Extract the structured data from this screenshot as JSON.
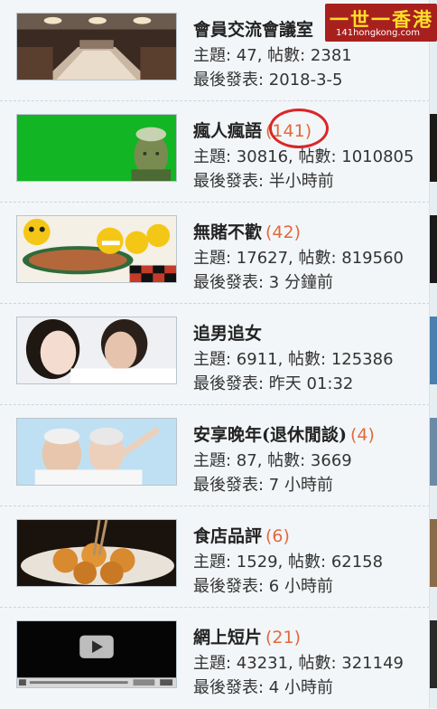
{
  "forums": [
    {
      "title": "會員交流會議室",
      "count": "",
      "topics": "主題: 47, 帖數: 2381",
      "last": "最後發表: 2018-3-5",
      "thumb": "conference-room"
    },
    {
      "title": "瘋人瘋語",
      "count": "(141)",
      "topics": "主題: 30816, 帖數: 1010805",
      "last": "最後發表: 半小時前",
      "thumb": "green-portrait"
    },
    {
      "title": "無賭不歡",
      "count": "(42)",
      "topics": "主題: 17627, 帖數: 819560",
      "last": "最後發表: 3 分鐘前",
      "thumb": "emoji-gambling"
    },
    {
      "title": "追男追女",
      "count": "",
      "topics": "主題: 6911, 帖數: 125386",
      "last": "最後發表: 昨天 01:32",
      "thumb": "couple"
    },
    {
      "title": "安享晚年(退休閒談)",
      "count": "(4)",
      "topics": "主題: 87, 帖數: 3669",
      "last": "最後發表: 7 小時前",
      "thumb": "elderly-couple"
    },
    {
      "title": "食店品評",
      "count": "(6)",
      "topics": "主題: 1529, 帖數: 62158",
      "last": "最後發表: 6 小時前",
      "thumb": "fishballs"
    },
    {
      "title": "網上短片",
      "count": "(21)",
      "topics": "主題: 43231, 帖數: 321149",
      "last": "最後發表: 4 小時前",
      "thumb": "video-player"
    }
  ],
  "watermark": {
    "main": "一世一香港",
    "sub": "141hongkong.com"
  },
  "colors": {
    "count": "#e26a3c",
    "highlight_circle": "#d9262a",
    "background": "#f3f6f8"
  }
}
